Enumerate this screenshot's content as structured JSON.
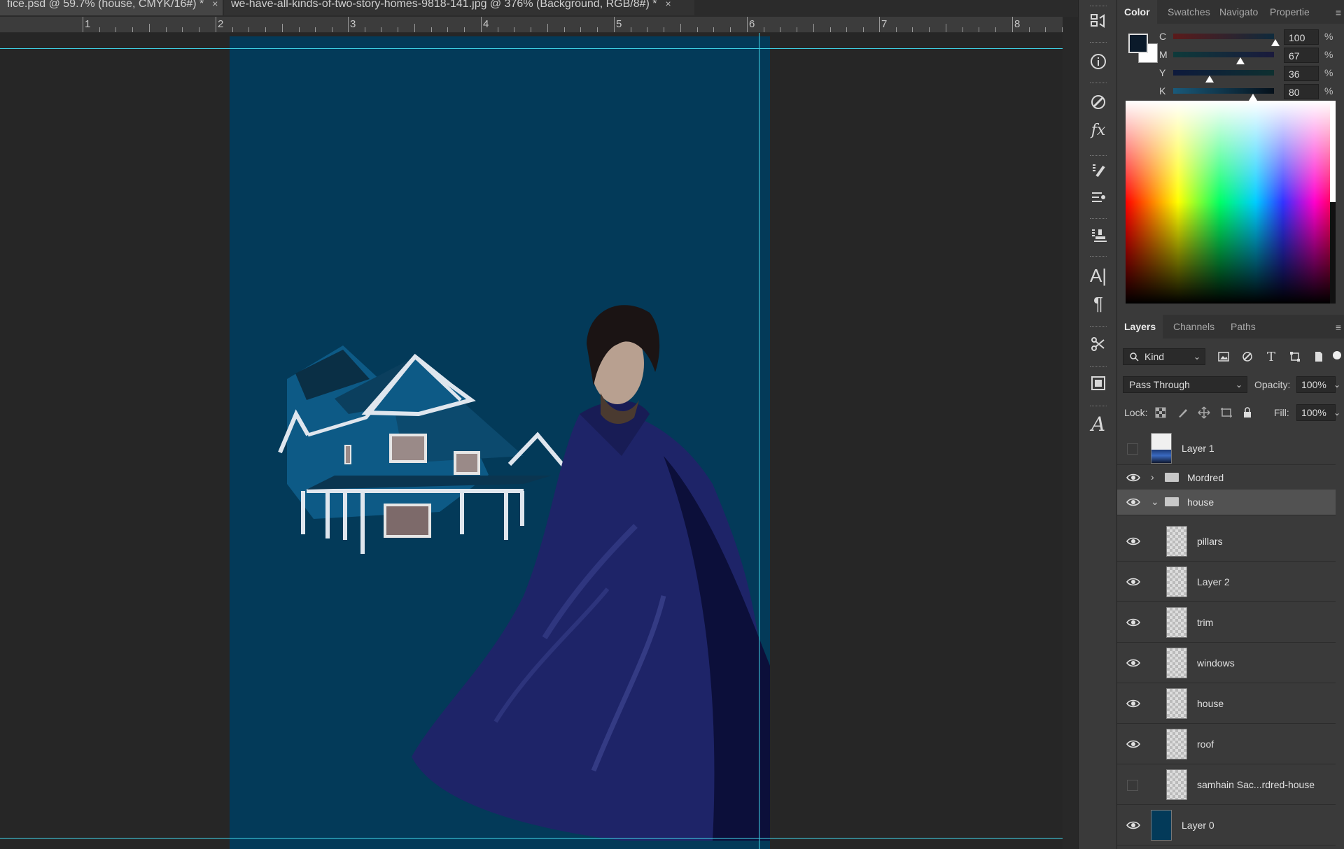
{
  "tabs": [
    {
      "label": "fice.psd @ 59.7% (house, CMYK/16#) *",
      "close": "×"
    },
    {
      "label": "we-have-all-kinds-of-two-story-homes-9818-141.jpg @ 376% (Background, RGB/8#) *",
      "close": "×"
    }
  ],
  "ruler": [
    "1",
    "2",
    "3",
    "4",
    "5",
    "6",
    "7",
    "8"
  ],
  "color_panel": {
    "tabs": [
      "Color",
      "Swatches",
      "Navigato",
      "Propertie"
    ],
    "foreground": "#0b1a2a",
    "background": "#ffffff",
    "channels": [
      {
        "label": "C",
        "value": "100",
        "unit": "%",
        "level": 1.0
      },
      {
        "label": "M",
        "value": "67",
        "unit": "%",
        "level": 0.67
      },
      {
        "label": "Y",
        "value": "36",
        "unit": "%",
        "level": 0.36
      },
      {
        "label": "K",
        "value": "80",
        "unit": "%",
        "level": 0.8
      }
    ]
  },
  "layers_panel": {
    "tabs": [
      "Layers",
      "Channels",
      "Paths"
    ],
    "filter": "Kind",
    "blend_mode": "Pass Through",
    "opacity_label": "Opacity:",
    "opacity": "100%",
    "lock_label": "Lock:",
    "fill_label": "Fill:",
    "fill": "100%",
    "layers": [
      {
        "name": "Layer 1",
        "visible": false
      },
      {
        "name": "Mordred",
        "visible": true,
        "group": true,
        "expanded": false
      },
      {
        "name": "house",
        "visible": true,
        "group": true,
        "expanded": true,
        "selected": true
      },
      {
        "name": "pillars",
        "visible": true
      },
      {
        "name": "Layer 2",
        "visible": true
      },
      {
        "name": "trim",
        "visible": true
      },
      {
        "name": "windows",
        "visible": true
      },
      {
        "name": "house",
        "visible": true
      },
      {
        "name": "roof",
        "visible": true
      },
      {
        "name": "samhain Sac...rdred-house",
        "visible": false
      },
      {
        "name": "Layer 0",
        "visible": true
      }
    ]
  },
  "colors": {
    "canvas_bg": "#033a59",
    "guide": "#3fd4e8",
    "cloak": "#1e2468",
    "house": "#0d5a86"
  }
}
